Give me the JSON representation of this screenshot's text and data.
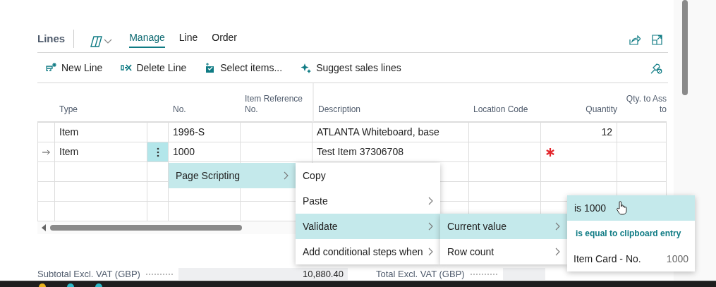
{
  "header": {
    "title": "Lines",
    "tabs": [
      {
        "label": "Manage",
        "selected": true
      },
      {
        "label": "Line",
        "selected": false
      },
      {
        "label": "Order",
        "selected": false
      }
    ]
  },
  "actions": [
    {
      "kind": "new",
      "label": "New Line"
    },
    {
      "kind": "delete",
      "label": "Delete Line"
    },
    {
      "kind": "select",
      "label": "Select items..."
    },
    {
      "kind": "suggest",
      "label": "Suggest sales lines"
    }
  ],
  "table": {
    "columns": [
      {
        "label": "Type"
      },
      {
        "label": "No."
      },
      {
        "label": "Item Reference No."
      },
      {
        "label": "Description"
      },
      {
        "label": "Location Code"
      },
      {
        "label": "Quantity"
      },
      {
        "label": "Qty. to Ass\nto"
      }
    ],
    "rows": [
      {
        "kind": "line",
        "current": false,
        "menu_open": false,
        "quantity_required": false,
        "type": "Item",
        "no": "1996-S",
        "description": "ATLANTA Whiteboard, base",
        "quantity": "12"
      },
      {
        "kind": "line",
        "current": true,
        "menu_open": true,
        "quantity_required": true,
        "type": "Item",
        "no": "1000",
        "description": "Test Item 37306708"
      },
      {
        "kind": "blank"
      },
      {
        "kind": "blank"
      },
      {
        "kind": "blank"
      }
    ]
  },
  "totals": [
    {
      "label": "Subtotal Excl. VAT (GBP)",
      "value": "10,880.40"
    },
    {
      "label": "Total Excl. VAT (GBP)"
    }
  ],
  "context_menus": [
    {
      "items": [
        {
          "kind": "entry",
          "label": "Page Scripting",
          "submenu": true,
          "selected": true
        }
      ]
    },
    {
      "items": [
        {
          "kind": "entry",
          "label": "Copy",
          "submenu": false,
          "selected": false
        },
        {
          "kind": "entry",
          "label": "Paste",
          "submenu": true,
          "selected": false
        },
        {
          "kind": "entry",
          "label": "Validate",
          "submenu": true,
          "selected": true
        },
        {
          "kind": "entry",
          "label": "Add conditional steps when",
          "submenu": true,
          "selected": false
        }
      ]
    },
    {
      "items": [
        {
          "kind": "entry",
          "label": "Current value",
          "submenu": true,
          "selected": true
        },
        {
          "kind": "entry",
          "label": "Row count",
          "submenu": true,
          "selected": false
        }
      ]
    },
    {
      "items": [
        {
          "kind": "option",
          "label": "is 1000",
          "selected": true
        },
        {
          "kind": "link",
          "label": "is equal to clipboard entry"
        },
        {
          "kind": "value",
          "label": "Item Card - No.",
          "value": "1000"
        }
      ]
    }
  ]
}
